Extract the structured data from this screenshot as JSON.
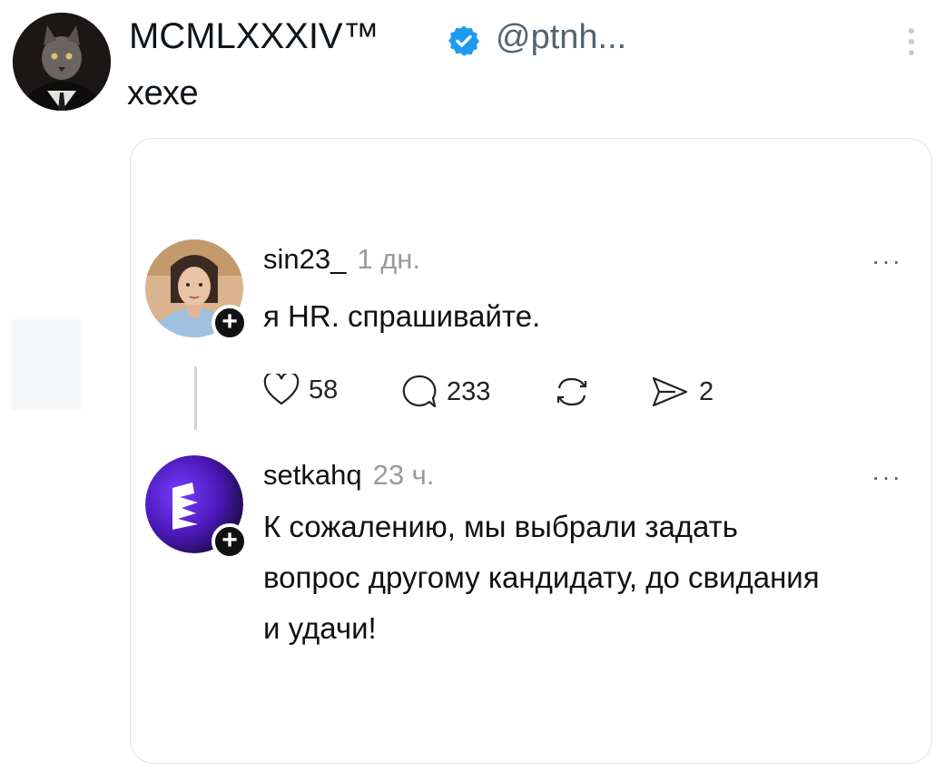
{
  "tweet": {
    "author_name": "MCMLXXXIV™",
    "handle": "@ptnh...",
    "text": "хехе",
    "icons": {
      "verified": "verified-badge-icon",
      "more": "more-vertical-icon"
    },
    "colors": {
      "verified": "#1d9bf0",
      "handle": "#536471"
    }
  },
  "embedded_post": {
    "comments": [
      {
        "username": "sin23_",
        "time": "1 дн.",
        "text": "я HR. спрашивайте.",
        "actions": {
          "likes": "58",
          "replies": "233",
          "shares": "2"
        }
      },
      {
        "username": "setkahq",
        "time": "23 ч.",
        "text_lines": [
          "К сожалению, мы выбрали задать",
          "вопрос другому кандидату, до свидания",
          "и удачи!"
        ]
      }
    ],
    "more_label": "···",
    "follow_label": "+"
  }
}
